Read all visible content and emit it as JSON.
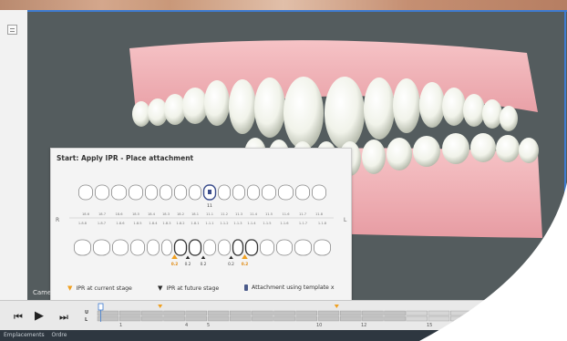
{
  "viewport": {
    "camera_label": "Came"
  },
  "ipr_panel": {
    "title": "Start: Apply IPR - Place attachment",
    "side_left": "R",
    "side_right": "L",
    "highlighted_tooth_label": "11",
    "upper_codes": [
      "18.6",
      "18.7",
      "18.6",
      "18.5",
      "18.4",
      "18.3",
      "18.2",
      "18.1",
      "11.1",
      "11.2",
      "11.3",
      "11.4",
      "11.5",
      "11.6",
      "11.7",
      "11.8"
    ],
    "lower_codes": [
      "1.8.8",
      "1.8.7",
      "1.8.6",
      "1.8.5",
      "1.8.4",
      "1.8.3",
      "1.8.2",
      "1.8.1",
      "1.1.1",
      "1.1.2",
      "1.1.3",
      "1.1.4",
      "1.1.5",
      "1.1.6",
      "1.1.7",
      "1.1.8"
    ],
    "ipr_values": [
      "0.2",
      "0.2",
      "0.2",
      "0.2",
      "0.2"
    ],
    "legend": {
      "current": "IPR at current stage",
      "future": "IPR at future stage",
      "attachment": "Attachment using template x"
    }
  },
  "timeline": {
    "u_label": "U",
    "l_label": "L",
    "tick_labels": [
      "1",
      "4",
      "5",
      "10",
      "12",
      "15"
    ],
    "current_marker_stage": 4,
    "future_marker_stage": 12
  },
  "status_bar": {
    "item1": "Emplacements",
    "item2": "Ordre"
  },
  "colors": {
    "gums": "#f1b0b5",
    "teeth": "#f3f5ee",
    "viewport_bg": "#545c5e",
    "ipr_current": "#f0a020",
    "accent_blue": "#3e7bd0"
  }
}
